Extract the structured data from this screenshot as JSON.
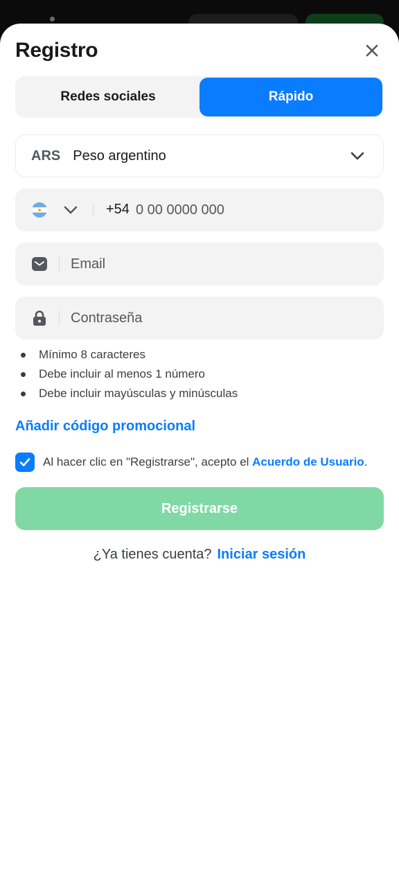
{
  "colors": {
    "accent": "#0a7cff",
    "submit_disabled": "#80d9a5",
    "field_bg": "#f3f3f4",
    "text_primary": "#1a1a1a",
    "text_secondary": "#55575e"
  },
  "dialog": {
    "title": "Registro",
    "close_icon": "close-icon"
  },
  "tabs": [
    {
      "label": "Redes sociales",
      "active": false
    },
    {
      "label": "Rápido",
      "active": true
    }
  ],
  "currency": {
    "code": "ARS",
    "name": "Peso argentino",
    "icon": "chevron-down-icon"
  },
  "phone": {
    "country_flag": "argentina-flag-icon",
    "prefix": "+54",
    "placeholder": "0 00 0000 000",
    "value": ""
  },
  "email": {
    "icon": "envelope-icon",
    "placeholder": "Email",
    "value": ""
  },
  "password": {
    "icon": "lock-icon",
    "placeholder": "Contraseña",
    "value": ""
  },
  "password_rules": [
    "Mínimo 8 caracteres",
    "Debe incluir al menos 1 número",
    "Debe incluir mayúsculas y minúsculas"
  ],
  "promo_link": "Añadir código promocional",
  "agreement": {
    "checked": true,
    "text": "Al hacer clic en \"Registrarse\", acepto el ",
    "link": "Acuerdo de Usuario",
    "suffix": "."
  },
  "submit_label": "Registrarse",
  "login": {
    "prompt": "¿Ya tienes cuenta?",
    "link": "Iniciar sesión"
  }
}
